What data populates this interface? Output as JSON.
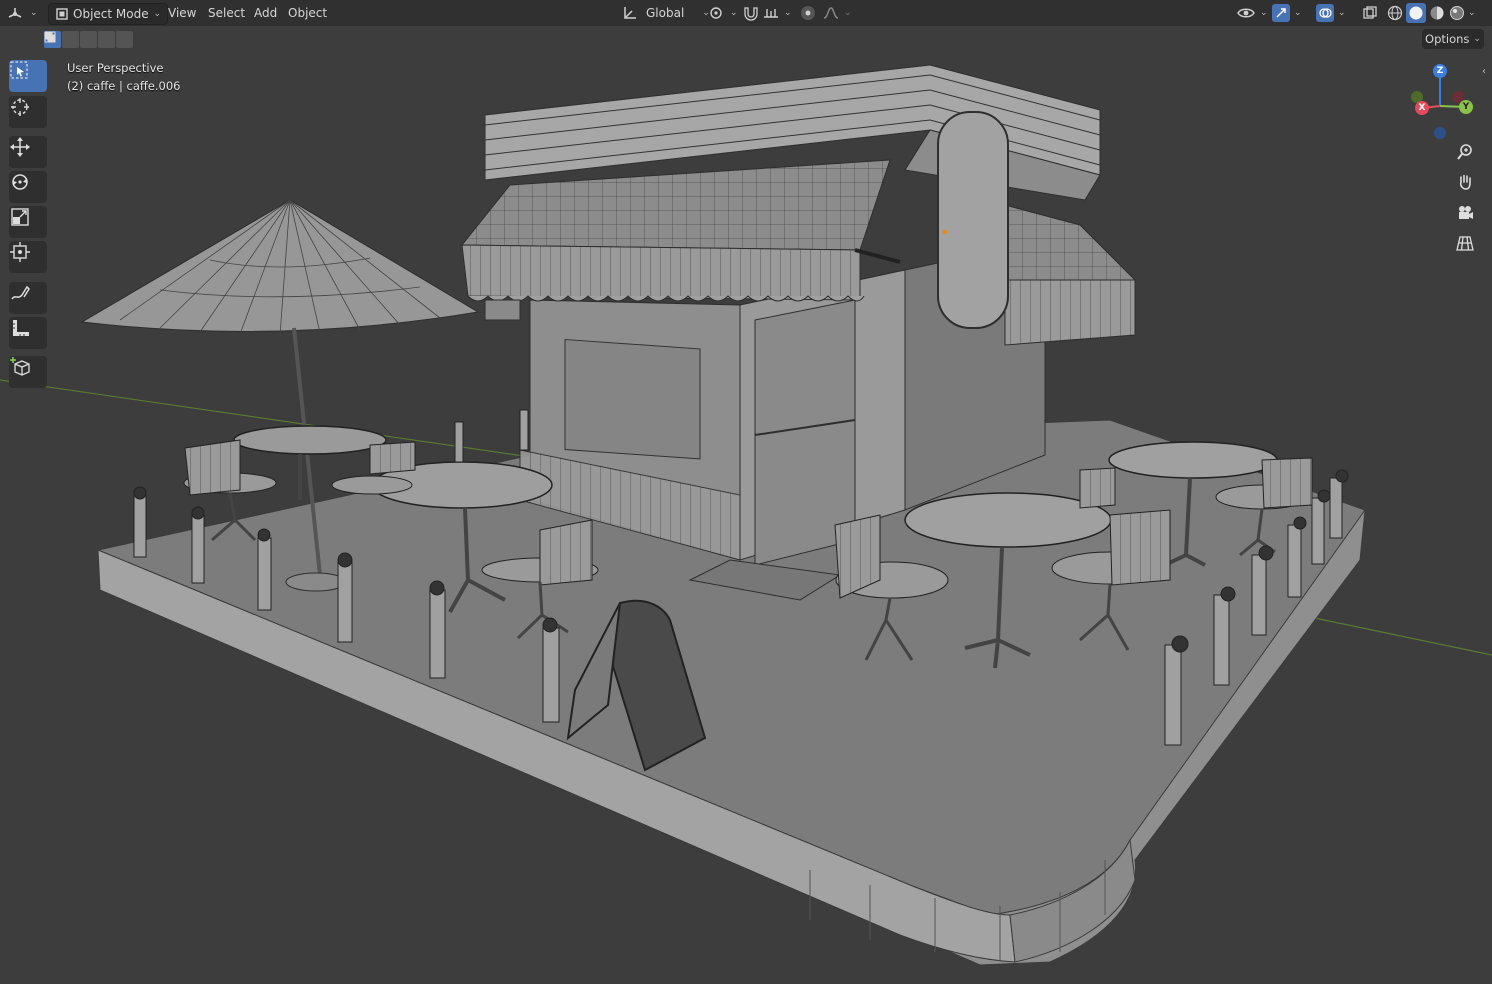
{
  "header": {
    "editor_type_icon": "3d-viewport-icon",
    "mode_label": "Object Mode",
    "menus": [
      "View",
      "Select",
      "Add",
      "Object"
    ],
    "transform_orientation": "Global",
    "options_label": "Options"
  },
  "viewport": {
    "view_name": "User Perspective",
    "object_info": "(2) caffe | caffe.006"
  },
  "gizmo": {
    "x_label": "X",
    "y_label": "Y",
    "z_label": "Z"
  },
  "toolbar": {
    "tools": [
      "select-box",
      "cursor",
      "move",
      "rotate",
      "scale",
      "transform",
      "annotate",
      "measure",
      "add-cube"
    ],
    "active_tool": "select-box"
  },
  "colors": {
    "header_bg": "#303030",
    "viewport_bg": "#3d3d3d",
    "accent": "#4772b3",
    "axis_x": "#e44a5a",
    "axis_y": "#8bc34a",
    "axis_z": "#3d7fe0"
  }
}
